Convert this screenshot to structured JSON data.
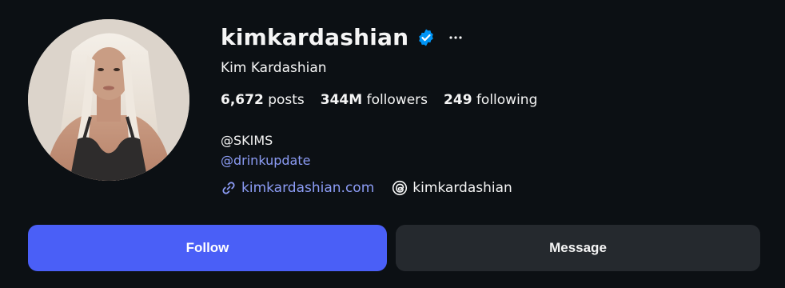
{
  "profile": {
    "username": "kimkardashian",
    "full_name": "Kim Kardashian",
    "verified": true,
    "avatar_icon": "profile-photo"
  },
  "stats": {
    "posts_count": "6,672",
    "posts_label": "posts",
    "followers_count": "344M",
    "followers_label": "followers",
    "following_count": "249",
    "following_label": "following"
  },
  "bio": {
    "line1": "@SKIMS",
    "line2": "@drinkupdate"
  },
  "links": {
    "website": "kimkardashian.com",
    "threads": "kimkardashian"
  },
  "actions": {
    "follow_label": "Follow",
    "message_label": "Message"
  },
  "colors": {
    "background": "#0c1014",
    "follow_button": "#4a5ff7",
    "message_button": "#25292e",
    "link": "#8c9cf5",
    "verified_badge": "#0095f6"
  }
}
